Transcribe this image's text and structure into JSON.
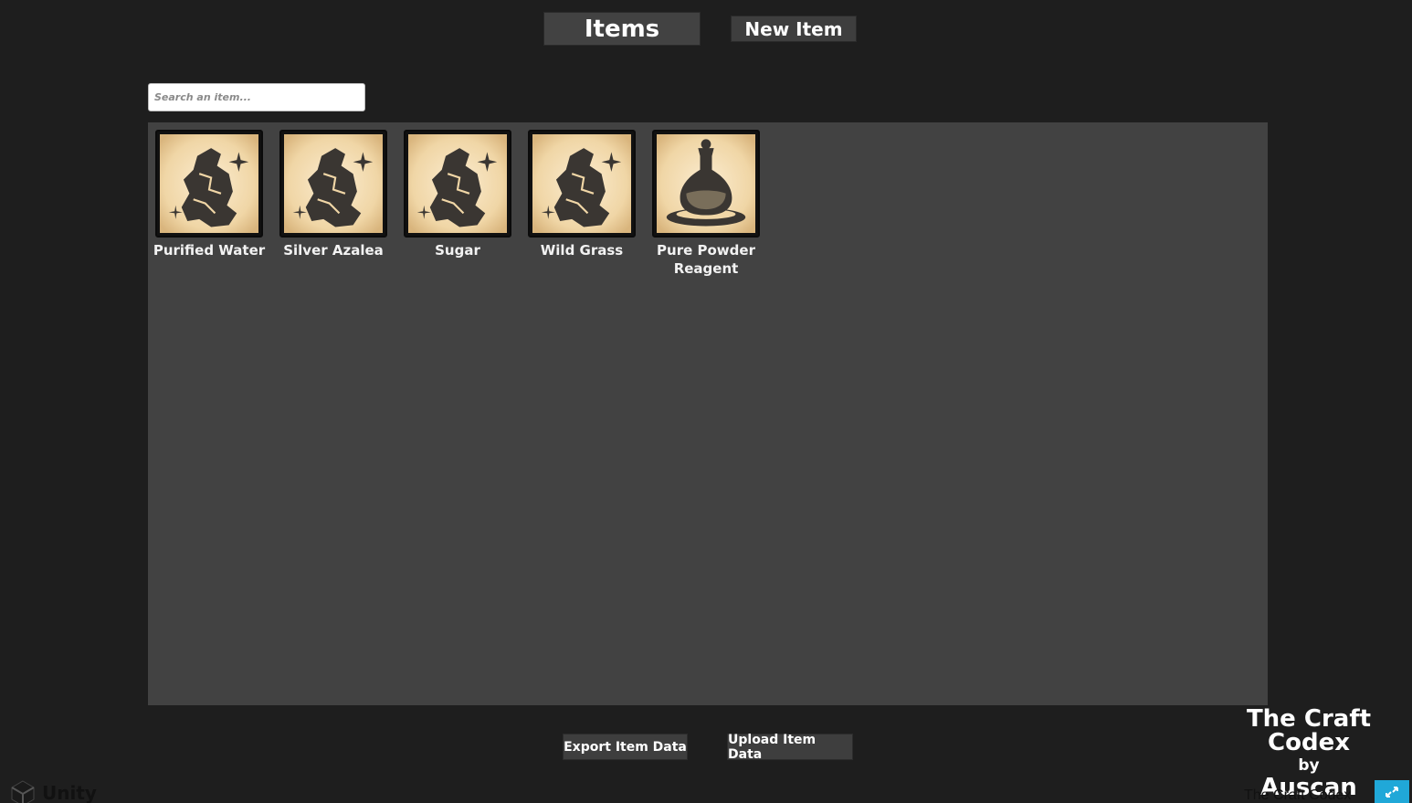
{
  "header": {
    "tab_items": "Items",
    "tab_new_item": "New Item"
  },
  "search": {
    "placeholder": "Search an item..."
  },
  "items": [
    {
      "name": "Purified Water",
      "icon": "ore-rock-icon"
    },
    {
      "name": "Silver Azalea",
      "icon": "ore-rock-icon"
    },
    {
      "name": "Sugar",
      "icon": "ore-rock-icon"
    },
    {
      "name": "Wild Grass",
      "icon": "ore-rock-icon"
    },
    {
      "name": "Pure Powder Reagent",
      "icon": "potion-flask-icon"
    }
  ],
  "footer": {
    "export_label": "Export Item Data",
    "upload_label": "Upload Item Data",
    "brand_line1": "The Craft Codex",
    "brand_line2": "by",
    "brand_line3": "Auscan",
    "unity_label": "Unity",
    "app_title": "The Craft Codex"
  },
  "colors": {
    "background": "#1e1e1e",
    "panel": "#424242",
    "parchment": "#f2dcb3",
    "icon_dark": "#3a3632",
    "fullscreen_accent": "#20a8d8"
  }
}
